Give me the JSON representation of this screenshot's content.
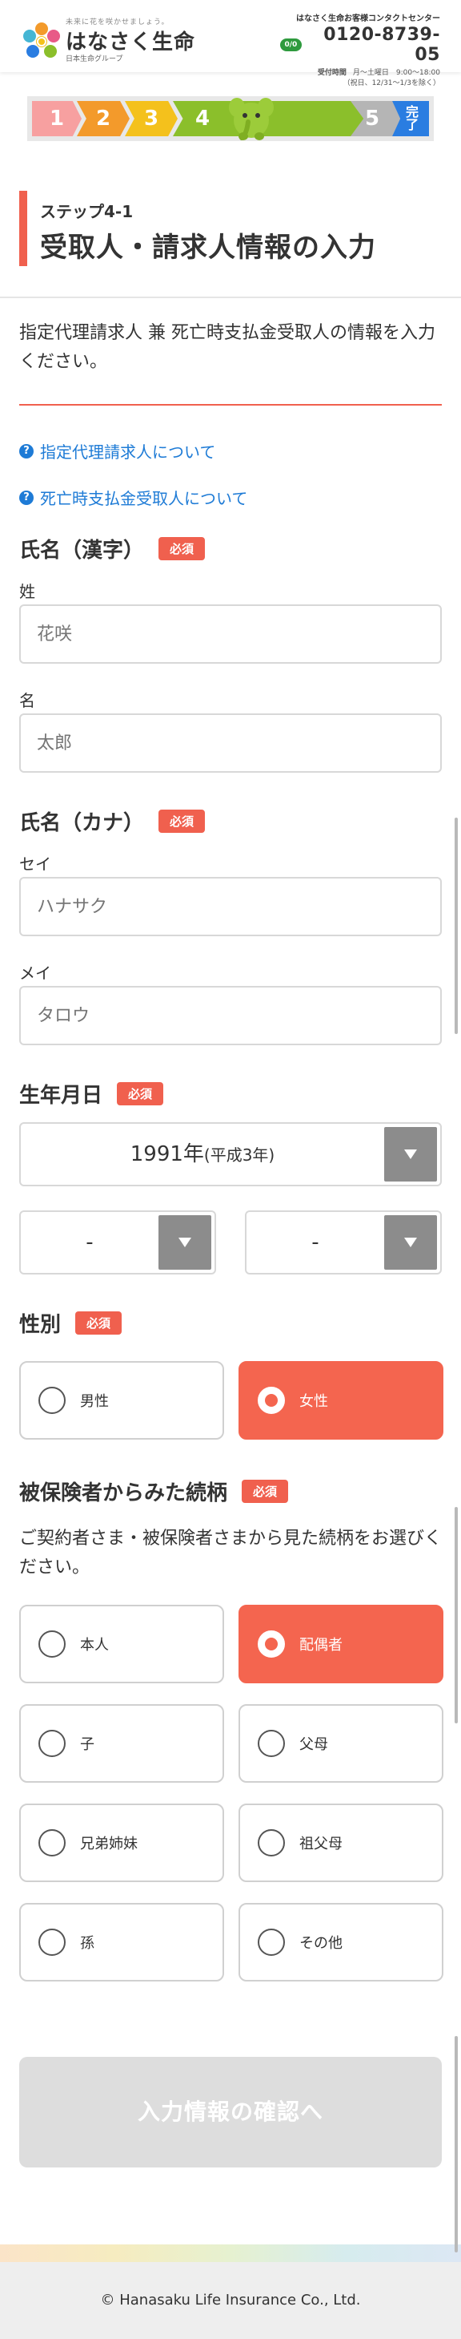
{
  "header": {
    "tagline": "未来に花を咲かせましょう。",
    "brand": "はなさく生命",
    "group": "日本生命グループ",
    "contact_title": "はなさく生命お客様コンタクトセンター",
    "freedial": "0/0",
    "tel": "0120-8739-05",
    "hours_label": "受付時間",
    "hours": "月〜土曜日　9:00〜18:00",
    "hours_note": "（祝日、12/31〜1/3を除く）"
  },
  "progress": {
    "steps": [
      "1",
      "2",
      "3",
      "4",
      "5"
    ],
    "done_line1": "完",
    "done_line2": "了",
    "current": 4
  },
  "title": {
    "step": "ステップ4-1",
    "main": "受取人・請求人情報の入力"
  },
  "intro": "指定代理請求人 兼 死亡時支払金受取人の情報を入力ください。",
  "help_links": [
    "指定代理請求人について",
    "死亡時支払金受取人について"
  ],
  "required_label": "必須",
  "name_kanji": {
    "label": "氏名（漢字）",
    "last_label": "姓",
    "last_placeholder": "花咲",
    "first_label": "名",
    "first_placeholder": "太郎"
  },
  "name_kana": {
    "label": "氏名（カナ）",
    "last_label": "セイ",
    "last_placeholder": "ハナサク",
    "first_label": "メイ",
    "first_placeholder": "タロウ"
  },
  "birthdate": {
    "label": "生年月日",
    "year": "1991年",
    "era": "(平成3年)",
    "month": "-",
    "day": "-"
  },
  "gender": {
    "label": "性別",
    "options": [
      "男性",
      "女性"
    ],
    "selected": "女性"
  },
  "relation": {
    "label": "被保険者からみた続柄",
    "description": "ご契約者さま・被保険者さまから見た続柄をお選びください。",
    "options": [
      "本人",
      "配偶者",
      "子",
      "父母",
      "兄弟姉妹",
      "祖父母",
      "孫",
      "その他"
    ],
    "selected": "配偶者"
  },
  "confirm_button": "入力情報の確認へ",
  "footer": "© Hanasaku Life Insurance Co., Ltd.",
  "colors": {
    "accent": "#f4654f",
    "link": "#1e7bd6",
    "step1": "#f7a0a0",
    "step2": "#f39a2b",
    "step3": "#f4c11c",
    "step4": "#8bbf2b",
    "step5": "#b5b5b5",
    "done": "#2a7de1"
  }
}
